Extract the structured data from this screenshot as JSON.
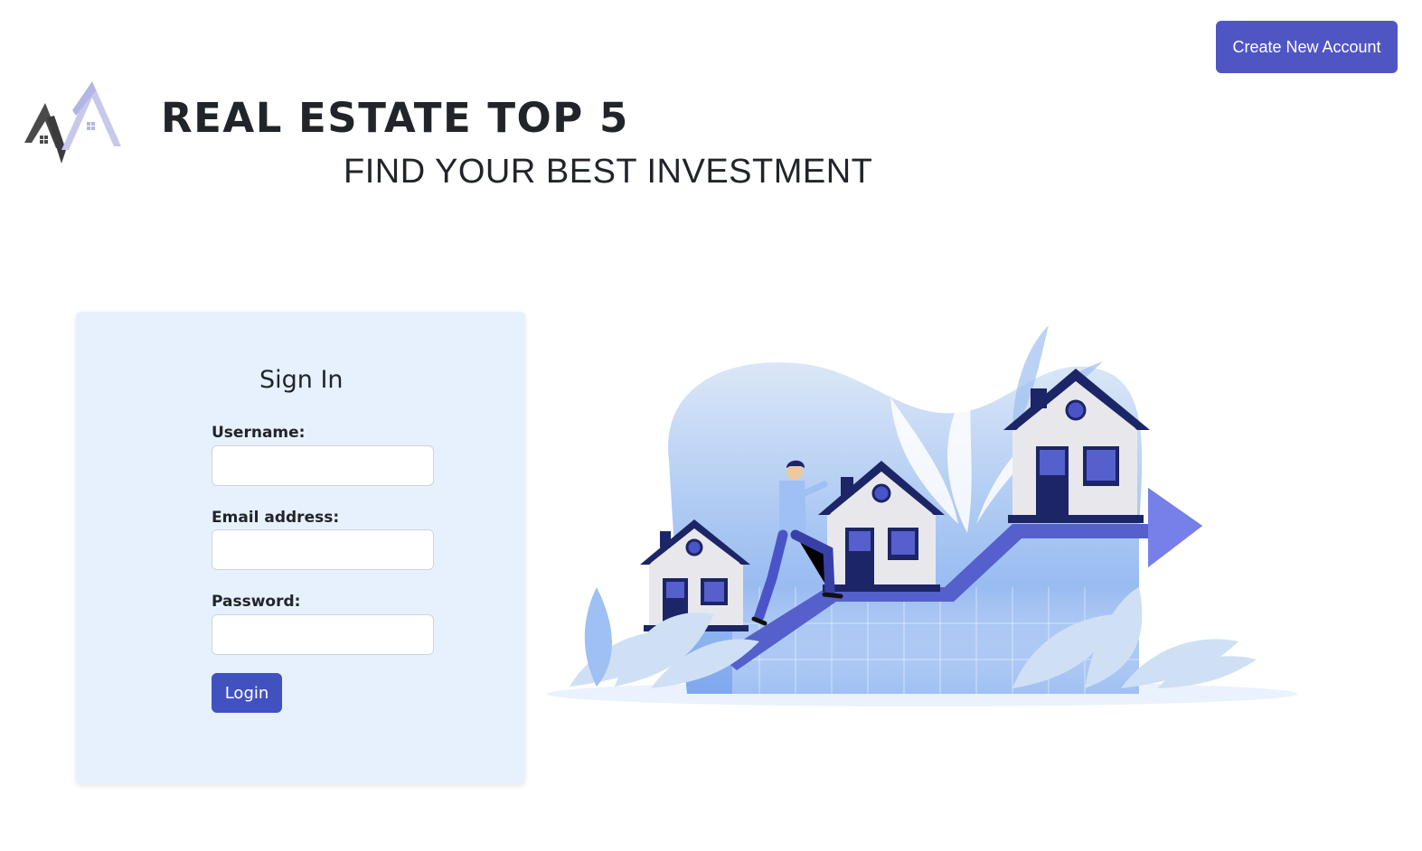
{
  "header": {
    "create_account_label": "Create New Account",
    "brand_title": "REAL ESTATE TOP 5",
    "brand_subtitle": "FIND YOUR BEST INVESTMENT"
  },
  "signin": {
    "title": "Sign In",
    "username_label": "Username:",
    "username_value": "",
    "email_label": "Email address:",
    "email_value": "",
    "password_label": "Password:",
    "password_value": "",
    "login_label": "Login"
  },
  "colors": {
    "accent": "#4f56c4",
    "login_button": "#4251c0",
    "card_background": "#e6f1fd"
  },
  "icons": {
    "logo": "house-mountains-logo-icon",
    "illustration": "houses-growth-arrow-illustration"
  }
}
